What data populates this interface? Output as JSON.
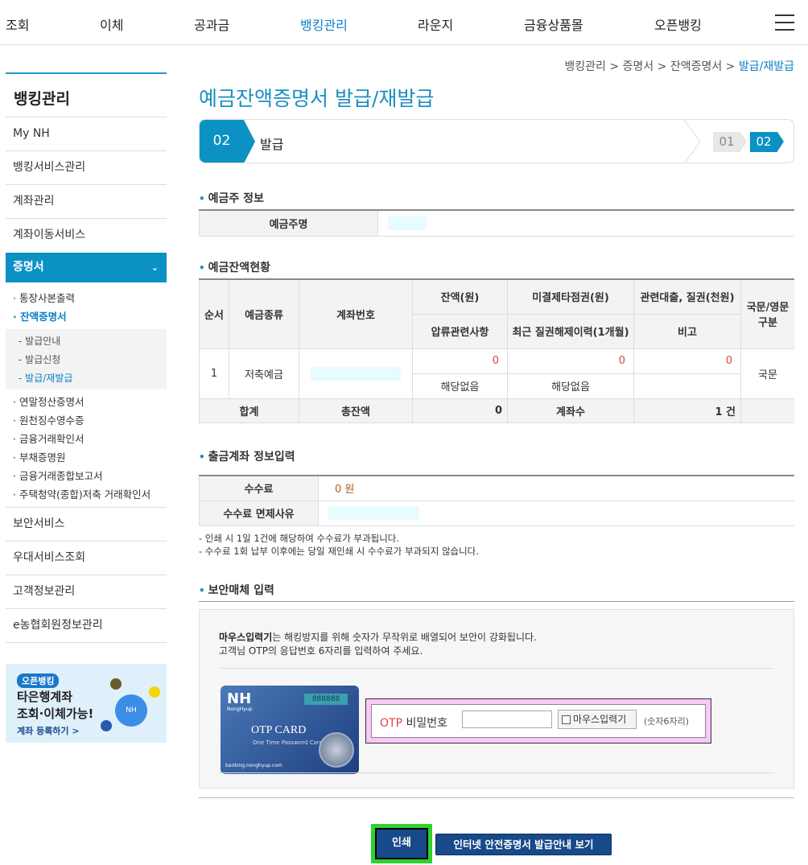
{
  "topnav": {
    "items": [
      "조회",
      "이체",
      "공과금",
      "뱅킹관리",
      "라운지",
      "금융상품몰",
      "오픈뱅킹"
    ],
    "active": "뱅킹관리"
  },
  "sidebar": {
    "title": "뱅킹관리",
    "items_top": [
      "My NH",
      "뱅킹서비스관리",
      "계좌관리",
      "계좌이동서비스"
    ],
    "active_item": "증명서",
    "active_chevron": "⌄",
    "sub_items": [
      "통장사본출력",
      "잔액증명서"
    ],
    "subsub_items": [
      "발급안내",
      "발급신청",
      "발급/재발급"
    ],
    "sub_items_2": [
      "연말정산증명서",
      "원천징수영수증",
      "금융거래확인서",
      "부채증명원",
      "금융거래종합보고서",
      "주택청약(종합)저축 거래확인서"
    ],
    "items_bottom": [
      "보안서비스",
      "우대서비스조회",
      "고객정보관리",
      "e농협회원정보관리"
    ],
    "banner": {
      "tag": "오픈뱅킹",
      "line1": "타은행계좌",
      "line2": "조회·이체가능!",
      "link": "계좌 등록하기 >",
      "circle_text": "NH"
    }
  },
  "breadcrumb": {
    "items": [
      "뱅킹관리",
      "증명서",
      "잔액증명서"
    ],
    "current": "발급/재발급",
    "sep": " > "
  },
  "page_title": "예금잔액증명서 발급/재발급",
  "steps": {
    "current_num": "02",
    "current_label": "발급",
    "mini": [
      "01",
      "02"
    ]
  },
  "depositor": {
    "section_title": "예금주 정보",
    "label": "예금주명"
  },
  "balance": {
    "section_title": "예금잔액현황",
    "headers": {
      "seq": "순서",
      "type": "예금종류",
      "account": "계좌번호",
      "balance": "잔액(원)",
      "uncleared": "미결제타점권(원)",
      "loan": "관련대출, 질권(천원)",
      "lang": "국문/영문 구분",
      "seizure": "압류관련사항",
      "pledge": "최근 질권해제이력(1개월)",
      "remark": "비고"
    },
    "row": {
      "seq": "1",
      "type": "저축예금",
      "balance": "0",
      "uncleared": "0",
      "loan": "0",
      "seizure": "해당없음",
      "pledge": "해당없음",
      "lang": "국문"
    },
    "total": {
      "label": "합계",
      "total_label": "총잔액",
      "total_value": "0",
      "count_label": "계좌수",
      "count_value": "1 건"
    }
  },
  "withdrawal": {
    "section_title": "출금계좌 정보입력",
    "fee_label": "수수료",
    "fee_value": "0 원",
    "exempt_label": "수수료 면제사유",
    "notes": [
      "- 인쇄 시 1일 1건에 해당하여 수수료가 부과됩니다.",
      "- 수수료 1회 납부 이후에는 당일 재인쇄 시 수수료가 부과되지 않습니다."
    ]
  },
  "security": {
    "section_title": "보안매체 입력",
    "desc_bold": "마우스입력기",
    "desc_rest": "는 해킹방지를 위해 숫자가 무작위로 배열되어 보안이 강화됩니다.",
    "desc2": "고객님 OTP의 응답번호 6자리를 입력하여 주세요.",
    "card": {
      "brand": "NH",
      "brand_sub": "NongHyup",
      "screen": "888888",
      "title": "OTP CARD",
      "subtitle": "One Time Password Card",
      "footer": "banking.nonghyup.com"
    },
    "otp_word": "OTP",
    "pw_label": " 비밀번호",
    "otp_value": "",
    "mouse_btn": "마우스입력기",
    "hint": "(숫자6자리)"
  },
  "buttons": {
    "print": "인쇄",
    "guide": "인터넷 안전증명서 발급안내 보기"
  },
  "colors": {
    "accent": "#0c91c3",
    "title": "#1a8fbf",
    "button": "#184a8a",
    "highlight": "#2ed22e",
    "otp_panel": "#f9c8f5"
  }
}
